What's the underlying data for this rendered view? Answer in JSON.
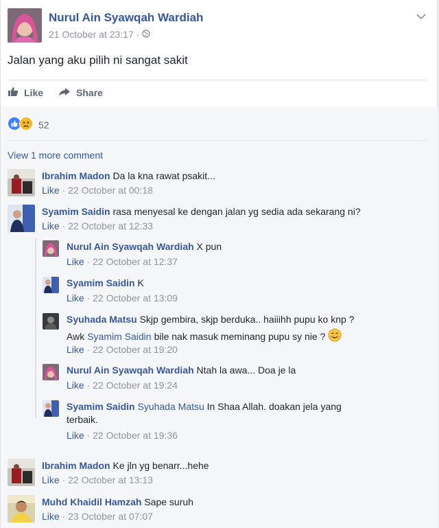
{
  "post": {
    "author": "Nurul Ain Syawqah Wardiah",
    "timestamp": "21 October at 23:17",
    "privacy_icon": "globe-icon",
    "text": "Jalan yang aku pilih ni sangat sakit"
  },
  "actions": {
    "like": "Like",
    "share": "Share"
  },
  "reactions": {
    "count": "52",
    "types": [
      "like",
      "sad"
    ]
  },
  "view_more": "View 1 more comment",
  "comments": [
    {
      "name": "Ibrahim Madon",
      "text": "Da la kna rawat psakit...",
      "like": "Like",
      "time": "22 October at 00:18"
    },
    {
      "name": "Syamim Saidin",
      "text": "rasa menyesal ke dengan jalan yg sedia ada sekarang ni?",
      "like": "Like",
      "time": "22 October at 12:33"
    },
    {
      "name": "Nurul Ain Syawqah Wardiah",
      "text": "X pun",
      "like": "Like",
      "time": "22 October at 12:37"
    },
    {
      "name": "Syamim Saidin",
      "text": "K",
      "like": "Like",
      "time": "22 October at 13:09"
    },
    {
      "name": "Syuhada Matsu",
      "text": "Skjp gembira, skjp berduka.. haiiihh pupu ko knp ?",
      "line2_pre": "Awk",
      "tag": "Syamim Saidin",
      "line2_post": "bile nak masuk meminang pupu sy nie ?",
      "like": "Like",
      "time": "22 October at 19:20"
    },
    {
      "name": "Nurul Ain Syawqah Wardiah",
      "text": "Ntah la awa... Doa je la",
      "like": "Like",
      "time": "22 October at 19:24"
    },
    {
      "name": "Syamim Saidin",
      "tag": "Syuhada Matsu",
      "text": "In Shaa Allah. doakan jela yang",
      "line2": "terbaik.",
      "like": "Like",
      "time": "22 October at 19:36"
    },
    {
      "name": "Ibrahim Madon",
      "text": "Ke jln yg benarr...hehe",
      "like": "Like",
      "time": "22 October at 13:13"
    },
    {
      "name": "Muhd Khaidil Hamzah",
      "text": "Sape suruh",
      "like": "Like",
      "time": "23 October at 07:07"
    }
  ],
  "colors": {
    "link": "#365899",
    "meta": "#90949c",
    "like_blue": "#4080ff",
    "sad_yellow": "#f7b928"
  }
}
